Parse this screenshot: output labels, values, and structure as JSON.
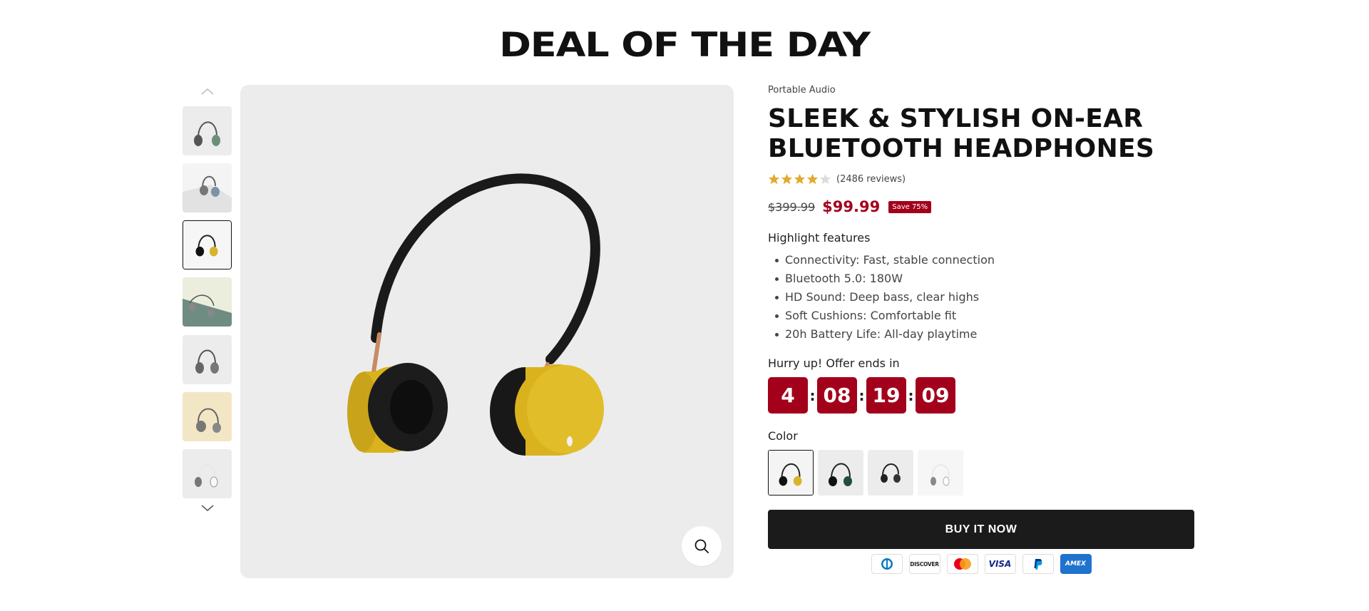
{
  "section": {
    "title": "DEAL OF THE DAY"
  },
  "product": {
    "vendor": "Portable Audio",
    "title_line1": "SLEEK & STYLISH ON-EAR",
    "title_line2": "BLUETOOTH HEADPHONES",
    "rating": 4,
    "rating_max": 5,
    "reviews": "(2486 reviews)",
    "compare_price": "$399.99",
    "price": "$99.99",
    "save_badge": "Save 75%"
  },
  "features": {
    "heading": "Highlight features",
    "items": [
      "Connectivity: Fast, stable connection",
      "Bluetooth 5.0: 180W",
      "HD Sound: Deep bass, clear highs",
      "Soft Cushions: Comfortable fit",
      "20h Battery Life: All-day playtime"
    ]
  },
  "countdown": {
    "label": "Hurry up! Offer ends in",
    "days": "4",
    "hours": "08",
    "minutes": "19",
    "seconds": "09",
    "separator": ":"
  },
  "color": {
    "label": "Color",
    "swatches": [
      "yellow",
      "green",
      "black",
      "white"
    ]
  },
  "buy": {
    "label": "BUY IT NOW"
  },
  "payments": [
    "Diners Club",
    "DISCOVER",
    "Mastercard",
    "VISA",
    "PayPal",
    "AMEX"
  ],
  "icons": {
    "thumb_up": "chevron-up-icon",
    "thumb_down": "chevron-down-icon",
    "zoom": "search-icon"
  },
  "colors": {
    "accent": "#a3001b",
    "star": "#e3a92b",
    "buy": "#1b1b1b",
    "media_bg": "#ececec"
  }
}
